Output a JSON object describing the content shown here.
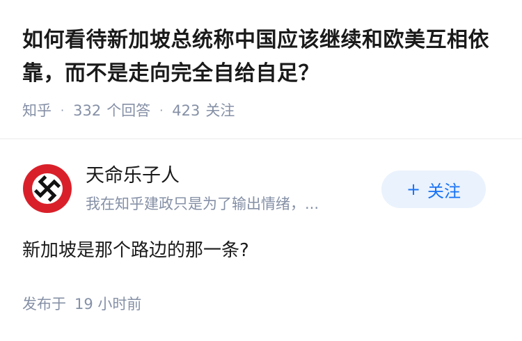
{
  "question": {
    "title": "如何看待新加坡总统称中国应该继续和欧美互相依靠，而不是走向完全自给自足？",
    "source": "知乎",
    "answer_count": "332",
    "answer_label": "个回答",
    "follower_count": "423",
    "follower_label": "关注"
  },
  "author": {
    "name": "天命乐子人",
    "bio": "我在知乎建政只是为了输出情绪，...",
    "avatar_icon": "red-circle-black-cross-emblem",
    "follow_label": "关注",
    "follow_icon": "plus-icon",
    "accent_color": "#1772f6"
  },
  "answer": {
    "content": "新加坡是那个路边的那一条?",
    "published_prefix": "发布于",
    "published_time": "19 小时前"
  }
}
